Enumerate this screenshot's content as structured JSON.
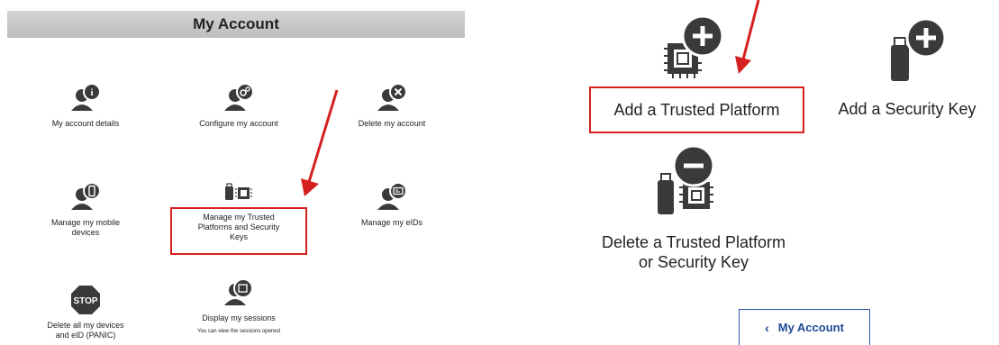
{
  "left_panel": {
    "title": "My Account",
    "tiles": [
      {
        "label": "My account details",
        "icon": "user-info-icon"
      },
      {
        "label": "Configure my account",
        "icon": "user-gear-icon"
      },
      {
        "label": "Delete my account",
        "icon": "user-delete-icon"
      },
      {
        "label": "Manage my mobile\ndevices",
        "icon": "user-mobile-icon"
      },
      {
        "label": "Manage my Trusted\nPlatforms and Security\nKeys",
        "icon": "usb-chip-icon"
      },
      {
        "label": "Manage my eIDs",
        "icon": "user-eid-icon"
      },
      {
        "label": "Delete all my devices\nand eID (PANIC)",
        "icon": "stop-icon",
        "icon_text": "STOP"
      },
      {
        "label": "Display my sessions",
        "sublabel": "You can view the sessions opened",
        "icon": "user-sessions-icon"
      }
    ]
  },
  "right_panel": {
    "tiles": [
      {
        "label": "Add a Trusted Platform",
        "icon": "chip-plus-icon"
      },
      {
        "label": "Add a Security Key",
        "icon": "usb-plus-icon"
      },
      {
        "label": "Delete a Trusted Platform\nor Security Key",
        "icon": "usb-chip-minus-icon"
      }
    ],
    "back_button": {
      "label": "My Account",
      "icon": "chevron-left-icon"
    }
  },
  "colors": {
    "highlight": "#d62020",
    "icon": "#3a3a3a",
    "link": "#1e4a96"
  }
}
